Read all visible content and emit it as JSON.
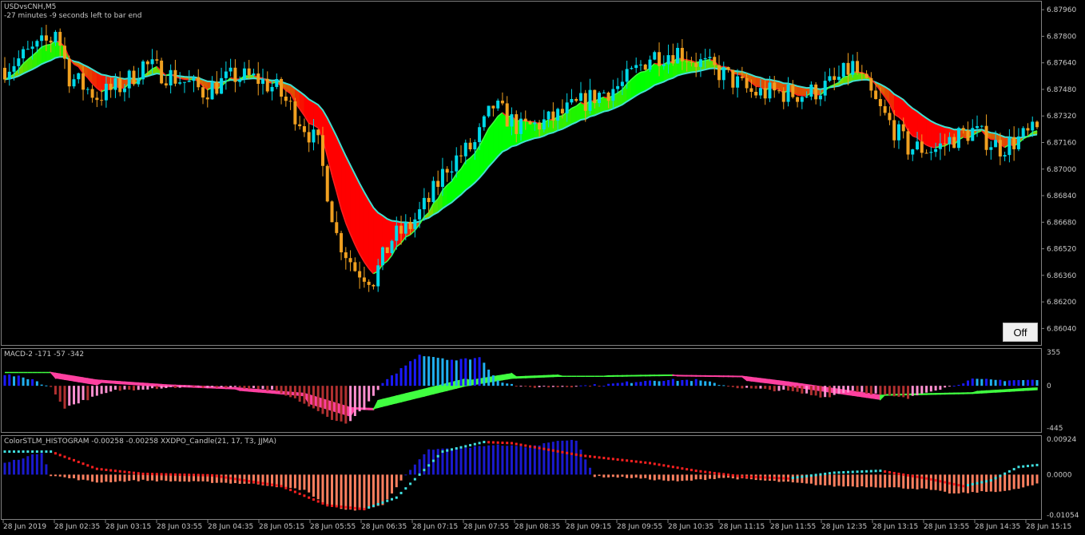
{
  "window": {
    "symbol_title": "USDvsCNH,M5",
    "timer_text": "-27 minutes -9 seconds left to bar end",
    "off_button_label": "Off"
  },
  "colors": {
    "background": "#000000",
    "frame": "#808080",
    "text": "#c8c8c8",
    "bull_candle": "#00d8e8",
    "bear_candle": "#f0a020",
    "fast_ma": "#ff2020",
    "fast_ma_alt": "#40ff40",
    "slow_ma": "#40e0d0",
    "cloud_up": "#00ff00",
    "cloud_down": "#ff0000",
    "macd_pos_strong": "#1a1aff",
    "macd_pos_weak": "#20b0f0",
    "macd_neg_strong": "#b03030",
    "macd_neg_weak": "#ff90d0",
    "macd_signal_up": "#40ff40",
    "macd_signal_down": "#ff40a0",
    "hist_pos": "#1a1acd",
    "hist_neg": "#ff8060",
    "hist_dots_up": "#40e0e0",
    "hist_dots_down": "#ff2020"
  },
  "chart_data": [
    {
      "type": "candlestick",
      "title": "USDvsCNH,M5",
      "y_ticks": [
        "6.87960",
        "6.87800",
        "6.87640",
        "6.87480",
        "6.87320",
        "6.87160",
        "6.87000",
        "6.86840",
        "6.86680",
        "6.86520",
        "6.86360",
        "6.86200",
        "6.86040"
      ],
      "ylim": [
        6.8596,
        6.8798
      ],
      "anchor_closes": [
        [
          0,
          6.8761
        ],
        [
          10,
          6.8778
        ],
        [
          11,
          6.8785
        ],
        [
          14,
          6.8756
        ],
        [
          20,
          6.8744
        ],
        [
          26,
          6.8751
        ],
        [
          30,
          6.8763
        ],
        [
          38,
          6.8754
        ],
        [
          43,
          6.8747
        ],
        [
          50,
          6.8756
        ],
        [
          55,
          6.8754
        ],
        [
          59,
          6.8748
        ],
        [
          64,
          6.873
        ],
        [
          68,
          6.8714
        ],
        [
          72,
          6.866
        ],
        [
          76,
          6.864
        ],
        [
          80,
          6.8634
        ],
        [
          84,
          6.8658
        ],
        [
          88,
          6.8666
        ],
        [
          92,
          6.8681
        ],
        [
          96,
          6.8702
        ],
        [
          102,
          6.8715
        ],
        [
          106,
          6.8738
        ],
        [
          112,
          6.8724
        ],
        [
          118,
          6.8729
        ],
        [
          124,
          6.8738
        ],
        [
          128,
          6.8744
        ],
        [
          134,
          6.8751
        ],
        [
          140,
          6.8768
        ],
        [
          146,
          6.8771
        ],
        [
          150,
          6.8765
        ],
        [
          156,
          6.8757
        ],
        [
          162,
          6.8746
        ],
        [
          168,
          6.8746
        ],
        [
          174,
          6.8745
        ],
        [
          180,
          6.8752
        ],
        [
          184,
          6.8762
        ],
        [
          190,
          6.8735
        ],
        [
          196,
          6.8713
        ],
        [
          202,
          6.8712
        ],
        [
          206,
          6.8719
        ],
        [
          210,
          6.8723
        ],
        [
          216,
          6.8713
        ],
        [
          220,
          6.8718
        ],
        [
          224,
          6.8723
        ]
      ]
    },
    {
      "type": "bar",
      "title": "MACD-2 -171 -57 -342",
      "y_ticks": [
        "355",
        "0",
        "-445"
      ],
      "ylim": [
        -445,
        355
      ],
      "anchor_values": [
        [
          0,
          120
        ],
        [
          6,
          70
        ],
        [
          10,
          -20
        ],
        [
          13,
          -230
        ],
        [
          18,
          -140
        ],
        [
          24,
          -50
        ],
        [
          30,
          -30
        ],
        [
          40,
          -10
        ],
        [
          50,
          -20
        ],
        [
          58,
          -50
        ],
        [
          64,
          -160
        ],
        [
          70,
          -330
        ],
        [
          74,
          -400
        ],
        [
          78,
          -240
        ],
        [
          82,
          20
        ],
        [
          86,
          180
        ],
        [
          90,
          330
        ],
        [
          98,
          270
        ],
        [
          103,
          300
        ],
        [
          107,
          60
        ],
        [
          112,
          -15
        ],
        [
          120,
          -10
        ],
        [
          130,
          10
        ],
        [
          140,
          60
        ],
        [
          150,
          60
        ],
        [
          160,
          -25
        ],
        [
          170,
          -55
        ],
        [
          178,
          -120
        ],
        [
          184,
          -50
        ],
        [
          190,
          -95
        ],
        [
          196,
          -135
        ],
        [
          200,
          -60
        ],
        [
          204,
          -20
        ],
        [
          210,
          65
        ],
        [
          216,
          60
        ],
        [
          222,
          60
        ]
      ],
      "anchor_signal": [
        [
          0,
          140
        ],
        [
          10,
          140
        ],
        [
          20,
          60
        ],
        [
          35,
          10
        ],
        [
          50,
          -20
        ],
        [
          65,
          -80
        ],
        [
          75,
          -230
        ],
        [
          80,
          -240
        ],
        [
          90,
          -120
        ],
        [
          100,
          0
        ],
        [
          110,
          80
        ],
        [
          120,
          100
        ],
        [
          130,
          100
        ],
        [
          145,
          110
        ],
        [
          160,
          100
        ],
        [
          170,
          40
        ],
        [
          180,
          -30
        ],
        [
          190,
          -100
        ],
        [
          200,
          -90
        ],
        [
          210,
          -80
        ],
        [
          224,
          -40
        ]
      ]
    },
    {
      "type": "bar",
      "title": "ColorSTLM_HISTOGRAM -0.00258 -0.00258 XXDPO_Candle(21, 17, T3, JJMA)",
      "y_ticks": [
        "0.00924",
        "0.0000",
        "-0.01054"
      ],
      "ylim": [
        -0.01054,
        0.00924
      ],
      "anchor_values": [
        [
          0,
          0.003
        ],
        [
          8,
          0.0058
        ],
        [
          10,
          -0.0002
        ],
        [
          20,
          -0.002
        ],
        [
          30,
          -0.0015
        ],
        [
          45,
          -0.002
        ],
        [
          55,
          -0.0025
        ],
        [
          65,
          -0.004
        ],
        [
          70,
          -0.008
        ],
        [
          76,
          -0.0095
        ],
        [
          82,
          -0.008
        ],
        [
          86,
          -0.0015
        ],
        [
          92,
          0.0065
        ],
        [
          100,
          0.007
        ],
        [
          106,
          0.0078
        ],
        [
          114,
          0.0072
        ],
        [
          120,
          0.009
        ],
        [
          124,
          0.0088
        ],
        [
          128,
          -0.0005
        ],
        [
          136,
          -0.0008
        ],
        [
          146,
          -0.0018
        ],
        [
          156,
          -0.0008
        ],
        [
          170,
          -0.002
        ],
        [
          180,
          -0.003
        ],
        [
          190,
          -0.0032
        ],
        [
          200,
          -0.0038
        ],
        [
          206,
          -0.005
        ],
        [
          212,
          -0.0045
        ],
        [
          218,
          -0.0042
        ],
        [
          224,
          -0.0025
        ]
      ],
      "anchor_dots": [
        [
          0,
          0.006
        ],
        [
          10,
          0.006
        ],
        [
          20,
          0.0015
        ],
        [
          30,
          0.0002
        ],
        [
          45,
          -0.0002
        ],
        [
          60,
          -0.003
        ],
        [
          70,
          -0.008
        ],
        [
          78,
          -0.009
        ],
        [
          85,
          -0.006
        ],
        [
          95,
          0.006
        ],
        [
          104,
          0.0085
        ],
        [
          110,
          0.0082
        ],
        [
          125,
          0.005
        ],
        [
          140,
          0.003
        ],
        [
          150,
          0.001
        ],
        [
          160,
          -0.0005
        ],
        [
          170,
          -0.001
        ],
        [
          180,
          0.0005
        ],
        [
          190,
          0.001
        ],
        [
          200,
          -0.001
        ],
        [
          208,
          -0.003
        ],
        [
          214,
          -0.0015
        ],
        [
          220,
          0.002
        ],
        [
          224,
          0.0025
        ]
      ]
    }
  ],
  "time_axis": {
    "labels": [
      "28 Jun 2019",
      "28 Jun 02:35",
      "28 Jun 03:15",
      "28 Jun 03:55",
      "28 Jun 04:35",
      "28 Jun 05:15",
      "28 Jun 05:55",
      "28 Jun 06:35",
      "28 Jun 07:15",
      "28 Jun 07:55",
      "28 Jun 08:35",
      "28 Jun 09:15",
      "28 Jun 09:55",
      "28 Jun 10:35",
      "28 Jun 11:15",
      "28 Jun 11:55",
      "28 Jun 12:35",
      "28 Jun 13:15",
      "28 Jun 13:55",
      "28 Jun 14:35",
      "28 Jun 15:15"
    ]
  }
}
